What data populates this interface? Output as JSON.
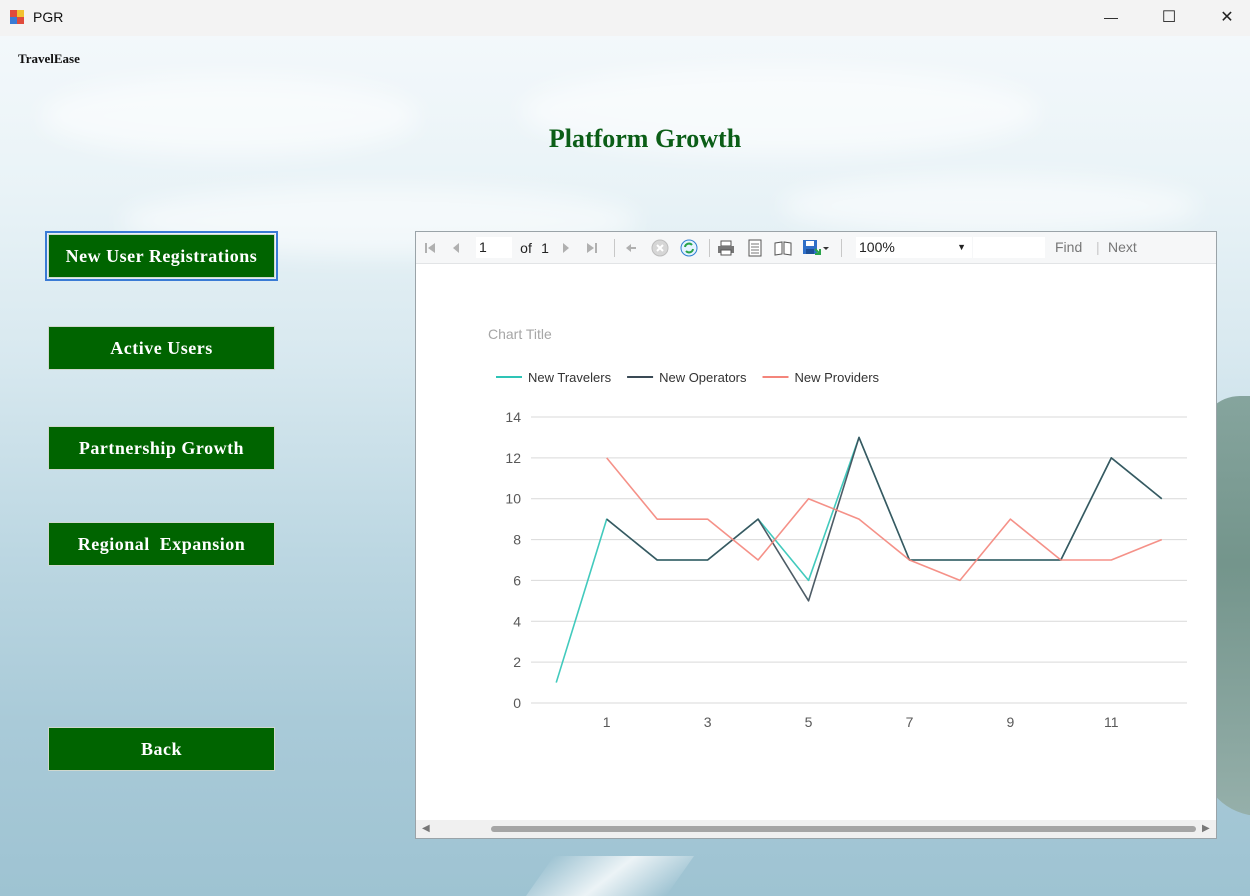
{
  "window": {
    "title": "PGR",
    "minimize": "—",
    "maximize": "☐",
    "close": "✕"
  },
  "brand": "TravelEase",
  "page_title": "Platform Growth",
  "nav": {
    "new_user_registrations": "New User Registrations",
    "active_users": "Active Users",
    "partnership_growth": "Partnership Growth",
    "regional_expansion": "Regional  Expansion",
    "back": "Back"
  },
  "report_toolbar": {
    "page_current": "1",
    "page_of": "of",
    "page_total": "1",
    "zoom": "100%",
    "find": "Find",
    "separator": "|",
    "next": "Next",
    "icons": [
      "first-page-icon",
      "previous-page-icon",
      "next-page-icon",
      "last-page-icon",
      "back-icon",
      "stop-icon",
      "refresh-icon",
      "print-icon",
      "print-layout-icon",
      "page-setup-icon",
      "export-icon"
    ]
  },
  "chart_data": {
    "type": "line",
    "title": "Chart Title",
    "x": [
      0,
      1,
      2,
      3,
      4,
      5,
      6,
      7,
      8,
      9,
      10,
      11,
      12
    ],
    "x_tick_labels": [
      "1",
      "3",
      "5",
      "7",
      "9",
      "11"
    ],
    "x_tick_values": [
      1,
      3,
      5,
      7,
      9,
      11
    ],
    "ylim": [
      0,
      14
    ],
    "y_ticks": [
      0,
      2,
      4,
      6,
      8,
      10,
      12,
      14
    ],
    "grid": true,
    "legend": "top-left",
    "series": [
      {
        "name": "New Travelers",
        "color": "#2ec4b6",
        "x": [
          0,
          1,
          2,
          3,
          4,
          5,
          6,
          7,
          8,
          9,
          10,
          11,
          12
        ],
        "values": [
          1,
          9,
          7,
          7,
          9,
          6,
          13,
          7,
          7,
          7,
          7,
          12,
          10
        ]
      },
      {
        "name": "New Operators",
        "color": "#3a4a55",
        "x": [
          1,
          2,
          3,
          4,
          5,
          6,
          7,
          8,
          9,
          10,
          11,
          12
        ],
        "values": [
          9,
          7,
          7,
          9,
          5,
          13,
          7,
          7,
          7,
          7,
          12,
          10
        ]
      },
      {
        "name": "New Providers",
        "color": "#f4857b",
        "x": [
          1,
          2,
          3,
          4,
          5,
          6,
          7,
          8,
          9,
          10,
          11,
          12
        ],
        "values": [
          12,
          9,
          9,
          7,
          10,
          9,
          7,
          6,
          9,
          7,
          7,
          8
        ]
      }
    ]
  }
}
